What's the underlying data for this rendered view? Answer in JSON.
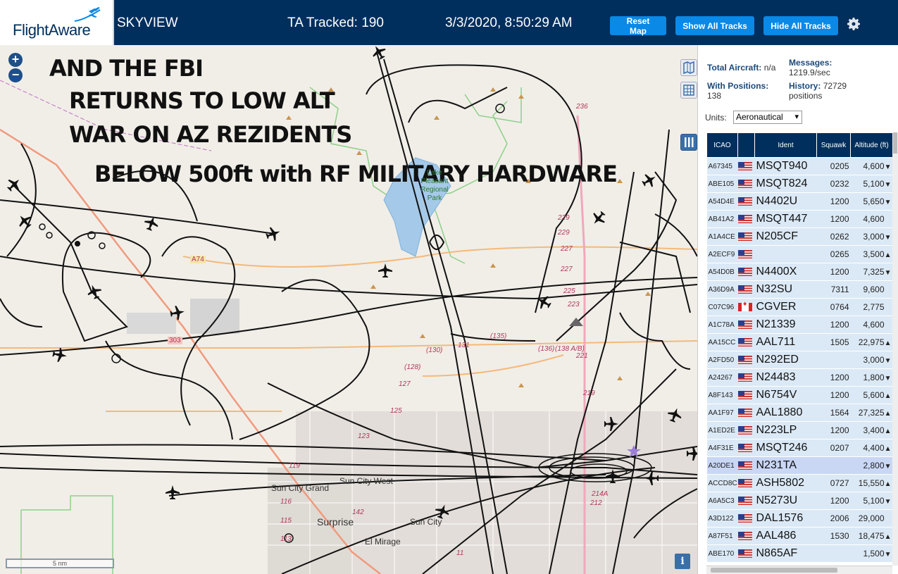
{
  "header": {
    "logo_text": "FlightAware",
    "app_title": "SKYVIEW",
    "tracked_label": "TA Tracked: 190",
    "datetime": "3/3/2020, 8:50:29 AM",
    "reset_label": "Reset Map",
    "show_label": "Show All Tracks",
    "hide_label": "Hide All Tracks",
    "settings_icon": "gear-icon",
    "accent_color": "#0a89e6",
    "bar_color": "#002f5d"
  },
  "map": {
    "zoom_in": "+",
    "zoom_out": "−",
    "overlay_lines": [
      "AND THE FBI",
      "RETURNS TO LOW ALT",
      "WAR ON AZ REZIDENTS",
      "BELOW 500ft with RF MILITARY HARDWARE"
    ],
    "places": [
      "Sun City Grand",
      "Sun City West",
      "Surprise",
      "Sun City",
      "El Mirage",
      "Lake Pleasant Regional Park"
    ],
    "highways": [
      "236",
      "229",
      "229",
      "227",
      "227",
      "225",
      "223",
      "221",
      "219",
      "(130)",
      "131",
      "(135)",
      "(136)",
      "(138 A/B)",
      "(128)",
      "127",
      "125",
      "123",
      "119",
      "116",
      "115",
      "113",
      "142",
      "11",
      "212",
      "214A",
      "A74",
      "303"
    ],
    "scale_label": "5 nm",
    "info_label": "i",
    "side_icons": [
      "map-icon",
      "grid-icon",
      "columns-icon"
    ]
  },
  "sidebar": {
    "total_aircraft_label": "Total Aircraft:",
    "total_aircraft_value": "n/a",
    "with_positions_label": "With Positions:",
    "with_positions_value": "138",
    "messages_label": "Messages:",
    "messages_value": "1219.9/sec",
    "history_label": "History:",
    "history_value": "72729 positions",
    "units_label": "Units:",
    "units_value": "Aeronautical",
    "columns": [
      "ICAO",
      "",
      "Ident",
      "Squawk",
      "Altitude (ft)"
    ],
    "rows": [
      {
        "icao": "A67345",
        "flag": "us",
        "ident": "MSQT940",
        "squawk": "0205",
        "alt": "4,600",
        "trend": "▼"
      },
      {
        "icao": "ABE105",
        "flag": "us",
        "ident": "MSQT824",
        "squawk": "0232",
        "alt": "5,100",
        "trend": "▼"
      },
      {
        "icao": "A54D4E",
        "flag": "us",
        "ident": "N4402U",
        "squawk": "1200",
        "alt": "5,650",
        "trend": "▼"
      },
      {
        "icao": "AB41A2",
        "flag": "us",
        "ident": "MSQT447",
        "squawk": "1200",
        "alt": "4,600",
        "trend": ""
      },
      {
        "icao": "A1A4CE",
        "flag": "us",
        "ident": "N205CF",
        "squawk": "0262",
        "alt": "3,000",
        "trend": "▼"
      },
      {
        "icao": "A2ECF9",
        "flag": "us",
        "ident": "",
        "squawk": "0265",
        "alt": "3,500",
        "trend": "▲"
      },
      {
        "icao": "A54D0B",
        "flag": "us",
        "ident": "N4400X",
        "squawk": "1200",
        "alt": "7,325",
        "trend": "▼"
      },
      {
        "icao": "A36D9A",
        "flag": "us",
        "ident": "N32SU",
        "squawk": "7311",
        "alt": "9,600",
        "trend": ""
      },
      {
        "icao": "C07C96",
        "flag": "ca",
        "ident": "CGVER",
        "squawk": "0764",
        "alt": "2,775",
        "trend": ""
      },
      {
        "icao": "A1C78A",
        "flag": "us",
        "ident": "N21339",
        "squawk": "1200",
        "alt": "4,600",
        "trend": ""
      },
      {
        "icao": "AA15CC",
        "flag": "us",
        "ident": "AAL711",
        "squawk": "1505",
        "alt": "22,975",
        "trend": "▲"
      },
      {
        "icao": "A2FD50",
        "flag": "us",
        "ident": "N292ED",
        "squawk": "",
        "alt": "3,000",
        "trend": "▼"
      },
      {
        "icao": "A24267",
        "flag": "us",
        "ident": "N24483",
        "squawk": "1200",
        "alt": "1,800",
        "trend": "▼"
      },
      {
        "icao": "A8F143",
        "flag": "us",
        "ident": "N6754V",
        "squawk": "1200",
        "alt": "5,600",
        "trend": "▲"
      },
      {
        "icao": "AA1F97",
        "flag": "us",
        "ident": "AAL1880",
        "squawk": "1564",
        "alt": "27,325",
        "trend": "▲"
      },
      {
        "icao": "A1ED2E",
        "flag": "us",
        "ident": "N223LP",
        "squawk": "1200",
        "alt": "3,400",
        "trend": "▲"
      },
      {
        "icao": "A4F31E",
        "flag": "us",
        "ident": "MSQT246",
        "squawk": "0207",
        "alt": "4,400",
        "trend": "▲"
      },
      {
        "icao": "A20DE1",
        "flag": "us",
        "ident": "N231TA",
        "squawk": "",
        "alt": "2,800",
        "trend": "▼",
        "selected": true
      },
      {
        "icao": "ACCD8C",
        "flag": "us",
        "ident": "ASH5802",
        "squawk": "0727",
        "alt": "15,550",
        "trend": "▲"
      },
      {
        "icao": "A6A5C3",
        "flag": "us",
        "ident": "N5273U",
        "squawk": "1200",
        "alt": "5,100",
        "trend": "▼"
      },
      {
        "icao": "A3D122",
        "flag": "us",
        "ident": "DAL1576",
        "squawk": "2006",
        "alt": "29,000",
        "trend": ""
      },
      {
        "icao": "A87F51",
        "flag": "us",
        "ident": "AAL486",
        "squawk": "1530",
        "alt": "18,475",
        "trend": "▲"
      },
      {
        "icao": "ABE170",
        "flag": "us",
        "ident": "N865AF",
        "squawk": "",
        "alt": "1,500",
        "trend": "▼"
      }
    ]
  }
}
